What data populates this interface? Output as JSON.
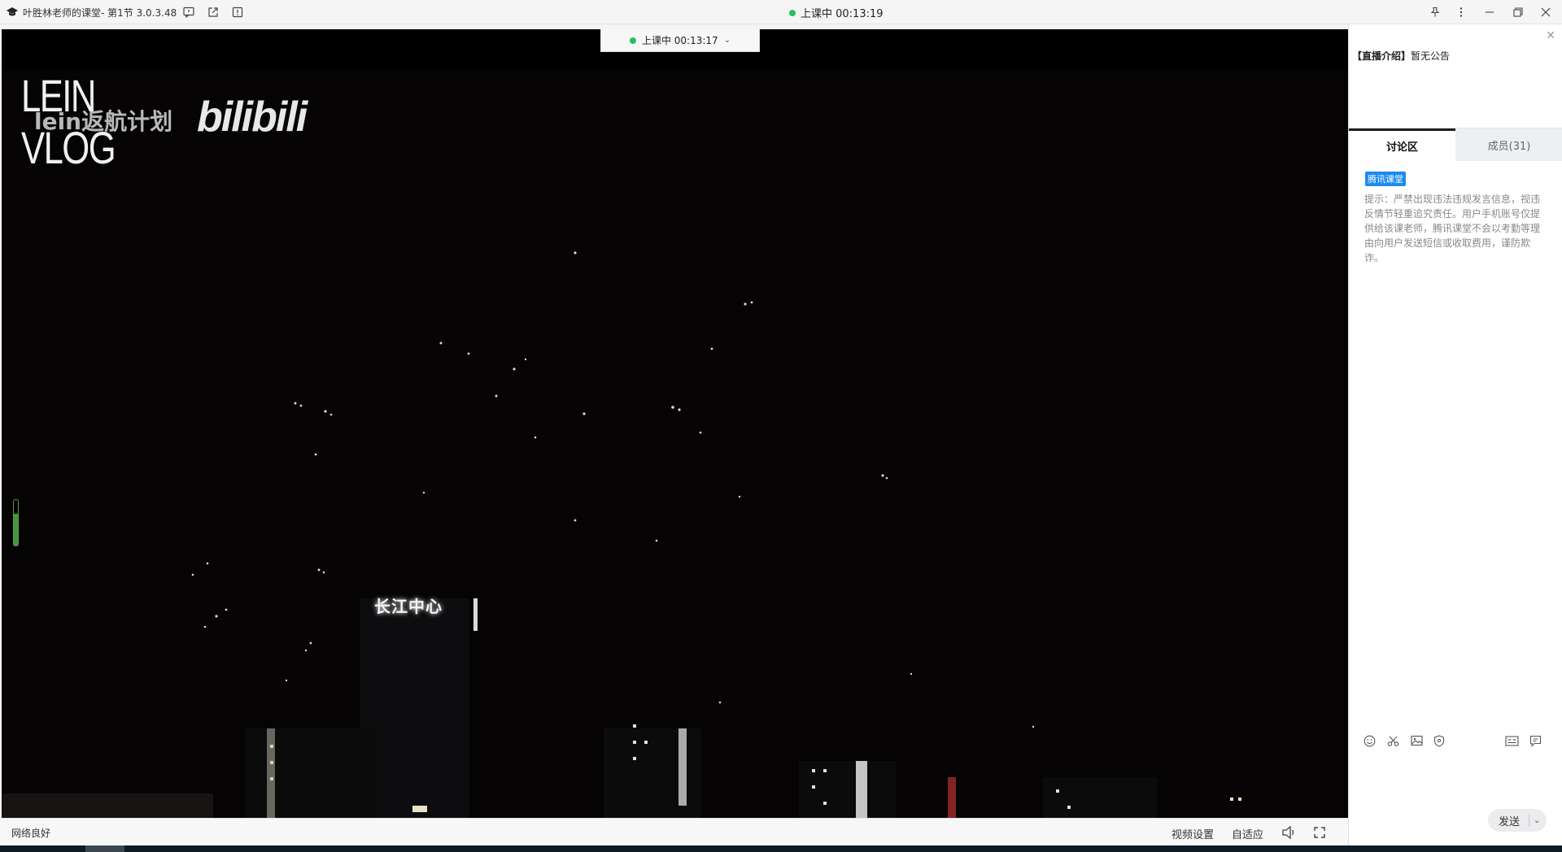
{
  "titlebar": {
    "title": "叶胜林老师的课堂- 第1节 3.0.3.48",
    "status": "上课中 00:13:19",
    "icons": [
      "graduation-cap-icon",
      "feedback-icon",
      "share-icon",
      "info-icon",
      "pin-icon",
      "more-icon",
      "minimize-icon",
      "restore-icon",
      "close-icon"
    ]
  },
  "video": {
    "pill_status": "上课中 00:13:17",
    "watermark_brand": "LEIN\nVLOG",
    "watermark_caption": "lein返航计划",
    "watermark_logo": "bilibili",
    "sign_text": "长江中心"
  },
  "bottombar": {
    "network": "网络良好",
    "video_settings": "视频设置",
    "fit": "自适应"
  },
  "panel": {
    "announce_label": "【直播介绍】",
    "announce_text": "暂无公告",
    "tabs": [
      {
        "label": "讨论区",
        "active": true
      },
      {
        "label": "成员(31)",
        "active": false
      }
    ],
    "badge": "腾讯课堂",
    "notice": "提示：严禁出现违法违规发言信息，视违反情节轻重追究责任。用户手机账号仅提供给该课老师，腾讯课堂不会以考勤等理由向用户发送短信或收取费用，谨防欺诈。",
    "send_label": "发送"
  },
  "colors": {
    "live_dot": "#23c35d",
    "badge_bg": "#1c8bf0",
    "video_bg": "#050303"
  }
}
